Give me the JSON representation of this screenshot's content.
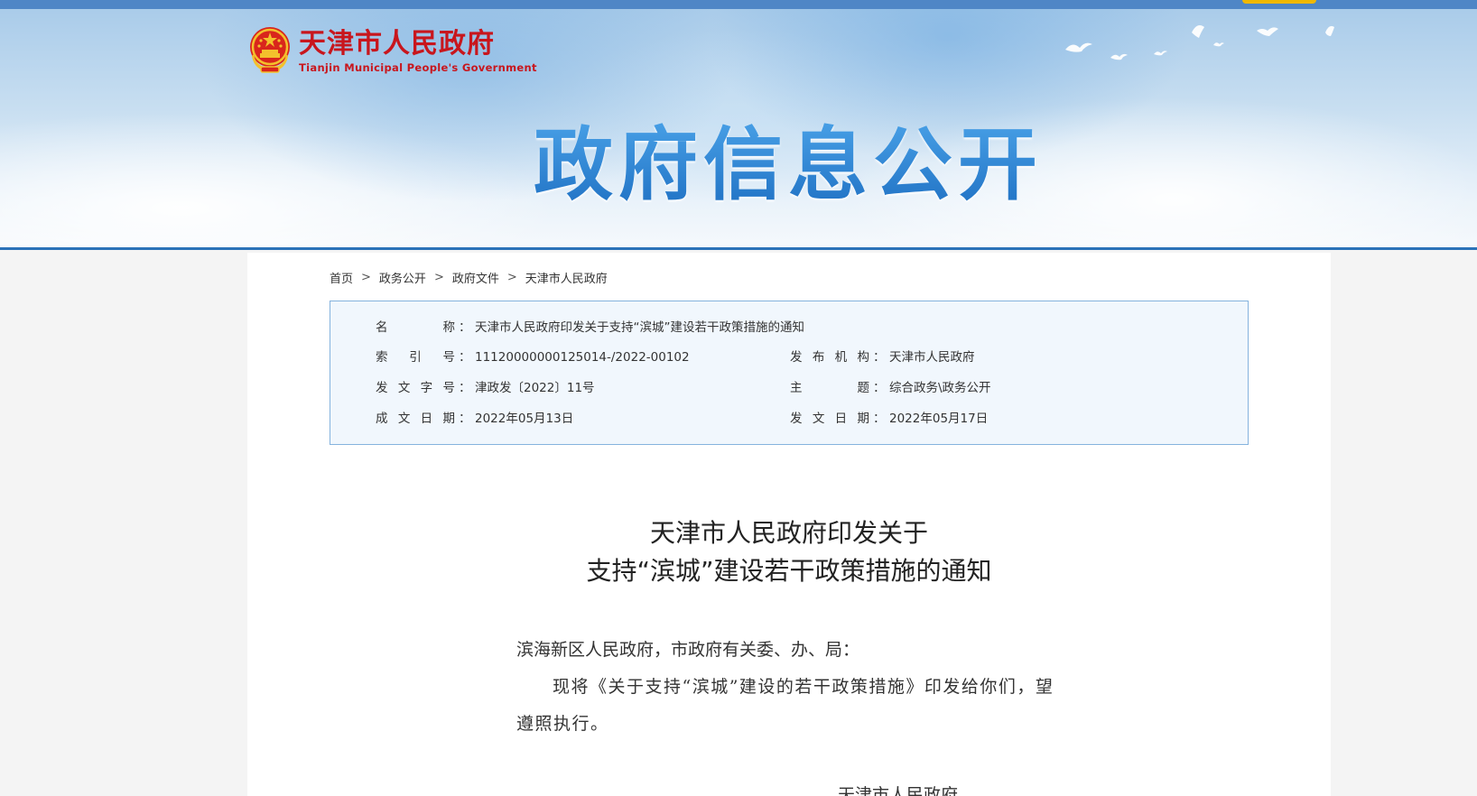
{
  "header": {
    "org_name_cn": "天津市人民政府",
    "org_name_en": "Tianjin Municipal People's Government",
    "banner_title": "政府信息公开"
  },
  "breadcrumb": {
    "items": [
      "首页",
      "政务公开",
      "政府文件",
      "天津市人民政府"
    ],
    "separator": ">"
  },
  "info": {
    "name_label": "名称",
    "name_value": "天津市人民政府印发关于支持“滨城”建设若干政策措施的通知",
    "index_label": "索引号",
    "index_value": "11120000000125014-/2022-00102",
    "publisher_label": "发布机构",
    "publisher_value": "天津市人民政府",
    "doc_number_label": "发文字号",
    "doc_number_value": "津政发〔2022〕11号",
    "subject_label": "主题",
    "subject_value": "综合政务\\政务公开",
    "written_date_label": "成文日期",
    "written_date_value": "2022年05月13日",
    "issued_date_label": "发文日期",
    "issued_date_value": "2022年05月17日",
    "colon": "："
  },
  "document": {
    "title_line1": "天津市人民政府印发关于",
    "title_line2": "支持“滨城”建设若干政策措施的通知",
    "salutation": "滨海新区人民政府，市政府有关委、办、局：",
    "paragraph1": "现将《关于支持“滨城”建设的若干政策措施》印发给你们，望遵照执行。",
    "signature": "天津市人民政府"
  },
  "colors": {
    "brand_red": "#c8161d",
    "brand_blue": "#2b72b8",
    "info_border": "#85b3de",
    "info_bg": "#f1f7fd"
  },
  "icons": {
    "emblem": "national-emblem-icon",
    "birds": "doves-icon"
  }
}
